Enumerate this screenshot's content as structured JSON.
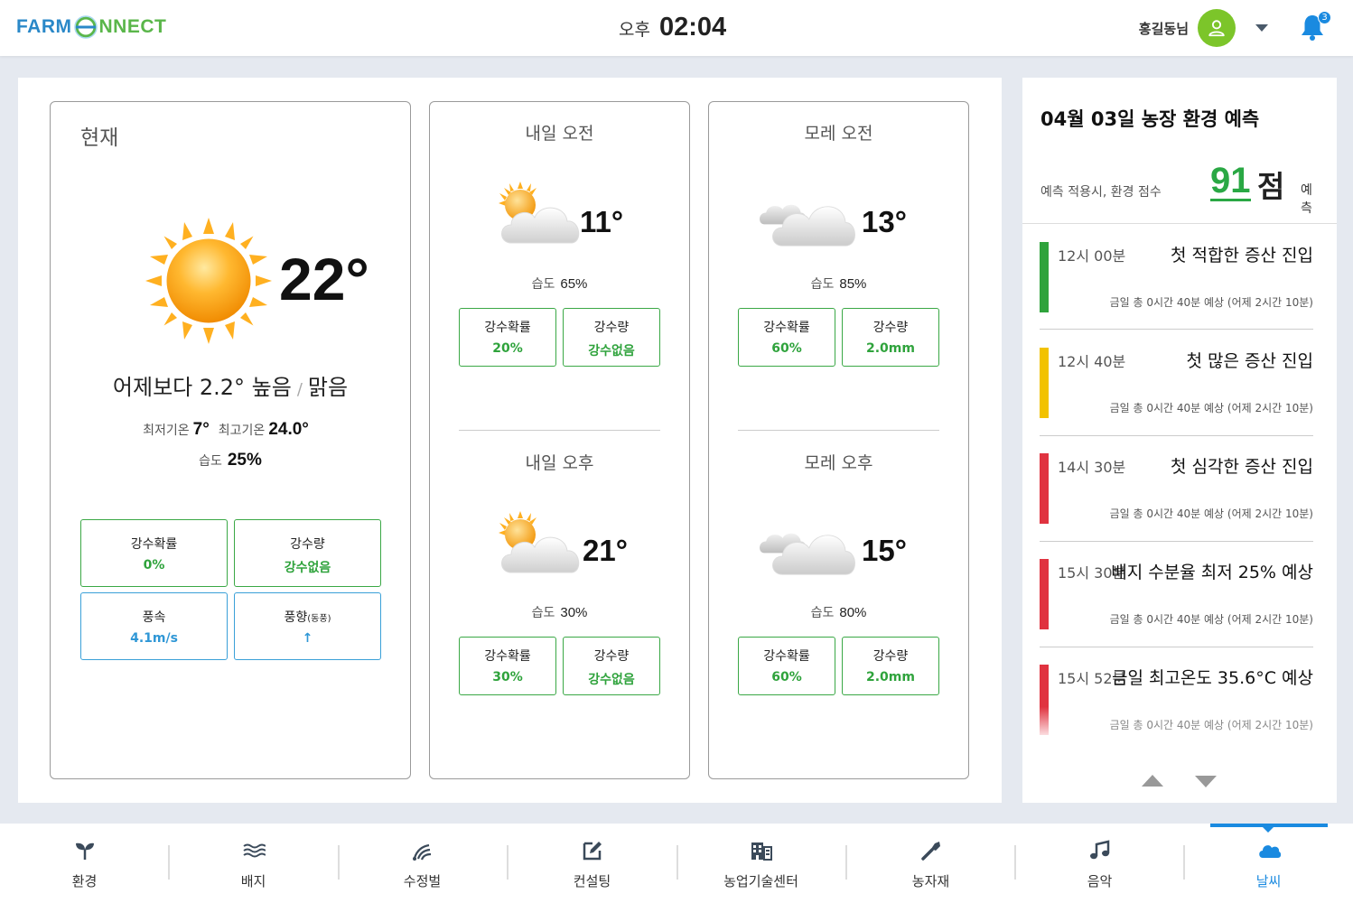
{
  "header": {
    "logo": {
      "part1": "FARM",
      "part2": "C",
      "part3": "NNECT"
    },
    "clock": {
      "ampm": "오후",
      "time": "02:04"
    },
    "user_name": "홍길동님",
    "notification_count": "3"
  },
  "current": {
    "title": "현재",
    "temp": "22°",
    "summary_diff": "어제보다 2.2° 높음",
    "summary_sep": "/",
    "summary_condition": "맑음",
    "min_label": "최저기온",
    "min_value": "7°",
    "max_label": "최고기온",
    "max_value": "24.0°",
    "humidity_label": "습도",
    "humidity_value": "25%",
    "boxes": [
      {
        "label": "강수확률",
        "value": "0%"
      },
      {
        "label": "강수량",
        "value": "강수없음"
      },
      {
        "label": "풍속",
        "value": "4.1m/s"
      },
      {
        "label": "풍향",
        "label_small": "(동풍)",
        "value": "↑"
      }
    ]
  },
  "forecasts": [
    {
      "title": "내일 오전",
      "icon": "partly-sunny-icon",
      "temp": "11°",
      "humidity_label": "습도",
      "humidity": "65%",
      "boxes": [
        {
          "label": "강수확률",
          "value": "20%"
        },
        {
          "label": "강수량",
          "value": "강수없음"
        }
      ]
    },
    {
      "title": "내일 오후",
      "icon": "partly-sunny-icon",
      "temp": "21°",
      "humidity_label": "습도",
      "humidity": "30%",
      "boxes": [
        {
          "label": "강수확률",
          "value": "30%"
        },
        {
          "label": "강수량",
          "value": "강수없음"
        }
      ]
    },
    {
      "title": "모레 오전",
      "icon": "cloudy-icon",
      "temp": "13°",
      "humidity_label": "습도",
      "humidity": "85%",
      "boxes": [
        {
          "label": "강수확률",
          "value": "60%"
        },
        {
          "label": "강수량",
          "value": "2.0mm"
        }
      ]
    },
    {
      "title": "모레 오후",
      "icon": "cloudy-icon",
      "temp": "15°",
      "humidity_label": "습도",
      "humidity": "80%",
      "boxes": [
        {
          "label": "강수확률",
          "value": "60%"
        },
        {
          "label": "강수량",
          "value": "2.0mm"
        }
      ]
    }
  ],
  "side": {
    "title": "04월 03일 농장 환경 예측",
    "score_label": "예측 적용시, 환경 점수",
    "score": "91",
    "score_unit": "점",
    "score_suffix": "예측",
    "alerts": [
      {
        "time": "12시 00분",
        "title": "첫 적합한 증산 진입",
        "desc": "금일 총 0시간 40분 예상 (어제 2시간 10분)",
        "color": "#2fa33c"
      },
      {
        "time": "12시 40분",
        "title": "첫 많은 증산 진입",
        "desc": "금일 총 0시간 40분 예상 (어제 2시간 10분)",
        "color": "#f2c200"
      },
      {
        "time": "14시 30분",
        "title": "첫 심각한 증산 진입",
        "desc": "금일 총 0시간 40분 예상 (어제 2시간 10분)",
        "color": "#e03340"
      },
      {
        "time": "15시 30분",
        "title": "배지 수분율 최저 25% 예상",
        "desc": "금일 총 0시간 40분 예상 (어제 2시간 10분)",
        "color": "#e03340"
      },
      {
        "time": "15시 52분",
        "title": "금일 최고온도 35.6°C 예상",
        "desc": "금일 총 0시간 40분 예상 (어제 2시간 10분)",
        "color": "#e03340"
      }
    ]
  },
  "nav": [
    {
      "label": "환경",
      "icon": "sprout-icon"
    },
    {
      "label": "배지",
      "icon": "waves-icon"
    },
    {
      "label": "수정벌",
      "icon": "bee-icon"
    },
    {
      "label": "컨설팅",
      "icon": "edit-icon"
    },
    {
      "label": "농업기술센터",
      "icon": "building-icon"
    },
    {
      "label": "농자재",
      "icon": "tools-icon"
    },
    {
      "label": "음악",
      "icon": "music-icon"
    },
    {
      "label": "날씨",
      "icon": "cloud-icon",
      "active": true
    }
  ],
  "colors": {
    "accent": "#1a8ae0",
    "green": "#2fa33c",
    "score": "#2aa844"
  }
}
